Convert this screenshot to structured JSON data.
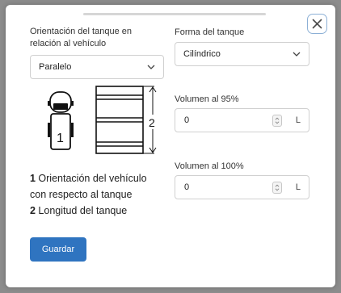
{
  "orientation": {
    "label_line1": "Orientación del tanque en",
    "label_line2": "relación al vehículo",
    "selected": "Paralelo"
  },
  "shape": {
    "label": "Forma del tanque",
    "selected": "Cilíndrico"
  },
  "diagram": {
    "marker_1": "1",
    "marker_2": "2"
  },
  "legend": [
    {
      "num": "1",
      "text": " Orientación del vehículo"
    },
    {
      "num": "",
      "text": "con respecto al tanque"
    },
    {
      "num": "2",
      "text": " Longitud del tanque"
    }
  ],
  "volume95": {
    "label": "Volumen al 95%",
    "value": "0",
    "unit": "L"
  },
  "volume100": {
    "label": "Volumen al 100%",
    "value": "0",
    "unit": "L"
  },
  "save_label": "Guardar",
  "icons": {
    "close": "close-icon",
    "chevron": "chevron-down-icon",
    "spinner": "spinner-icon"
  },
  "colors": {
    "accent": "#2f74c0",
    "close_border": "#8cb0d6"
  }
}
